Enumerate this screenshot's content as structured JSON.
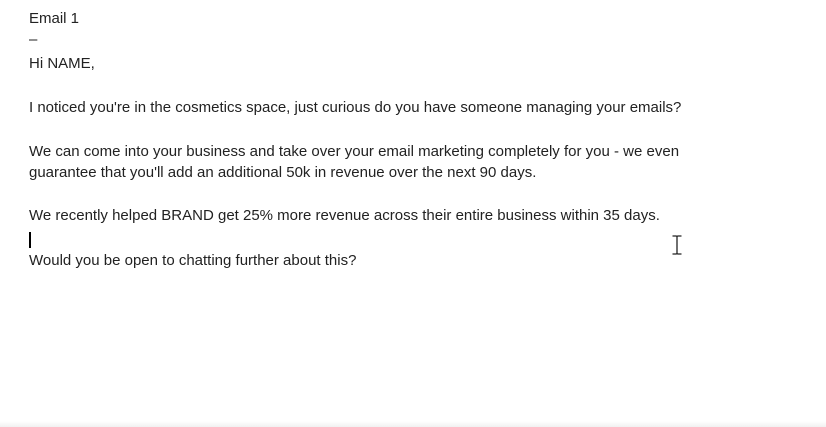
{
  "email": {
    "title": "Email 1",
    "separator": "–",
    "greeting": "Hi NAME,",
    "paragraph1": "I noticed you're in the cosmetics space, just curious do you have someone managing your emails?",
    "paragraph2_line1": "We can come into your business and take over your email marketing completely for you - we even",
    "paragraph2_line2": "guarantee that you'll add an additional 50k in revenue over the next 90 days.",
    "paragraph3": "We recently helped BRAND get 25% more revenue across their entire business within 35 days.",
    "closing": "Would you be open to chatting further about this?"
  },
  "icons": {
    "text_cursor": "text-caret-icon",
    "mouse_pointer": "ibeam-cursor-icon"
  }
}
